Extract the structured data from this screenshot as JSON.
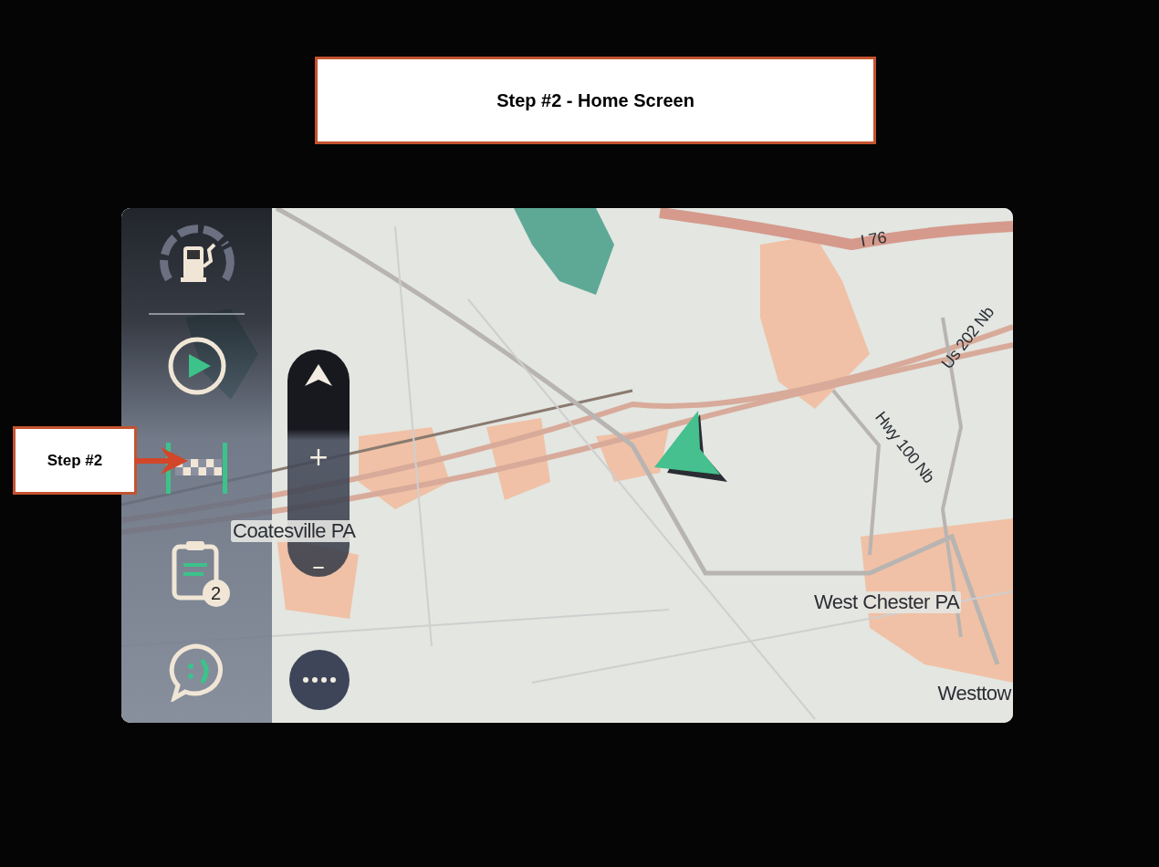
{
  "callout_title": "Step #2 - Home Screen",
  "callout_step": "Step #2",
  "sidebar": {
    "items": [
      {
        "kind": "fuel"
      },
      {
        "kind": "drive"
      },
      {
        "kind": "destination"
      },
      {
        "kind": "route_list",
        "badge": "2"
      },
      {
        "kind": "feedback"
      }
    ]
  },
  "zoom": {
    "plus": "+",
    "minus": "–"
  },
  "map": {
    "labels": [
      {
        "text": "I 76",
        "kind": "road"
      },
      {
        "text": "Us 202 Nb",
        "kind": "road"
      },
      {
        "text": "Hwy 100 Nb",
        "kind": "road"
      },
      {
        "text": "Coatesville PA",
        "kind": "place"
      },
      {
        "text": "West Chester PA",
        "kind": "place"
      },
      {
        "text": "Westtow",
        "kind": "place"
      }
    ]
  }
}
